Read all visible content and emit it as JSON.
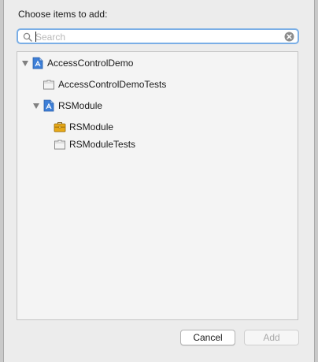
{
  "dialog": {
    "title": "Choose items to add:"
  },
  "search": {
    "placeholder": "Search",
    "value": ""
  },
  "tree": {
    "items": [
      {
        "label": "AccessControlDemo",
        "icon": "xcode-project-icon",
        "expanded": true
      },
      {
        "label": "AccessControlDemoTests",
        "icon": "test-bundle-icon"
      },
      {
        "label": "RSModule",
        "icon": "xcode-project-icon",
        "expanded": true
      },
      {
        "label": "RSModule",
        "icon": "framework-toolbox-icon"
      },
      {
        "label": "RSModuleTests",
        "icon": "test-bundle-icon"
      }
    ]
  },
  "buttons": {
    "cancel": "Cancel",
    "add": "Add",
    "add_enabled": false
  },
  "colors": {
    "focus_ring": "#7aaee6",
    "project_icon_blue": "#3d7fd8",
    "toolbox_yellow": "#e6a817"
  }
}
